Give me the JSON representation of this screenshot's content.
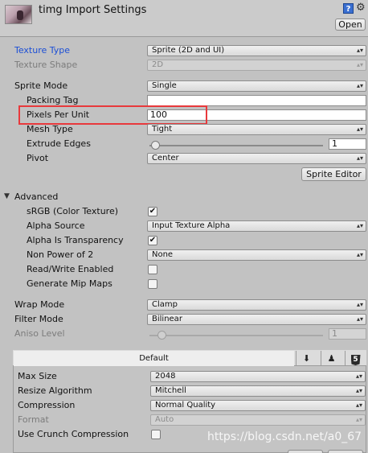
{
  "header": {
    "title": "timg Import Settings",
    "help_icon": "?",
    "open_label": "Open"
  },
  "texture": {
    "type_label": "Texture Type",
    "type_value": "Sprite (2D and UI)",
    "shape_label": "Texture Shape",
    "shape_value": "2D"
  },
  "sprite": {
    "mode_label": "Sprite Mode",
    "mode_value": "Single",
    "packing_tag_label": "Packing Tag",
    "packing_tag_value": "",
    "ppu_label": "Pixels Per Unit",
    "ppu_value": "100",
    "mesh_type_label": "Mesh Type",
    "mesh_type_value": "Tight",
    "extrude_label": "Extrude Edges",
    "extrude_value": "1",
    "pivot_label": "Pivot",
    "pivot_value": "Center",
    "editor_label": "Sprite Editor"
  },
  "advanced": {
    "header_label": "Advanced",
    "srgb_label": "sRGB (Color Texture)",
    "srgb_checked": "✔",
    "alpha_source_label": "Alpha Source",
    "alpha_source_value": "Input Texture Alpha",
    "alpha_transparency_label": "Alpha Is Transparency",
    "alpha_transparency_checked": "✔",
    "npot_label": "Non Power of 2",
    "npot_value": "None",
    "readwrite_label": "Read/Write Enabled",
    "mipmaps_label": "Generate Mip Maps"
  },
  "wrap": {
    "wrap_label": "Wrap Mode",
    "wrap_value": "Clamp",
    "filter_label": "Filter Mode",
    "filter_value": "Bilinear",
    "aniso_label": "Aniso Level",
    "aniso_value": "1"
  },
  "platform": {
    "tab_default": "Default",
    "download_icon": "⬇",
    "android_icon": "♟",
    "html5_icon": "5",
    "max_size_label": "Max Size",
    "max_size_value": "2048",
    "resize_label": "Resize Algorithm",
    "resize_value": "Mitchell",
    "compression_label": "Compression",
    "compression_value": "Normal Quality",
    "format_label": "Format",
    "format_value": "Auto",
    "crunch_label": "Use Crunch Compression"
  },
  "watermark": "https://blog.csdn.net/a0_67",
  "icons": {
    "dropdown_arrow": "▴▾",
    "gear": "⚙",
    "foldout": "▼"
  }
}
